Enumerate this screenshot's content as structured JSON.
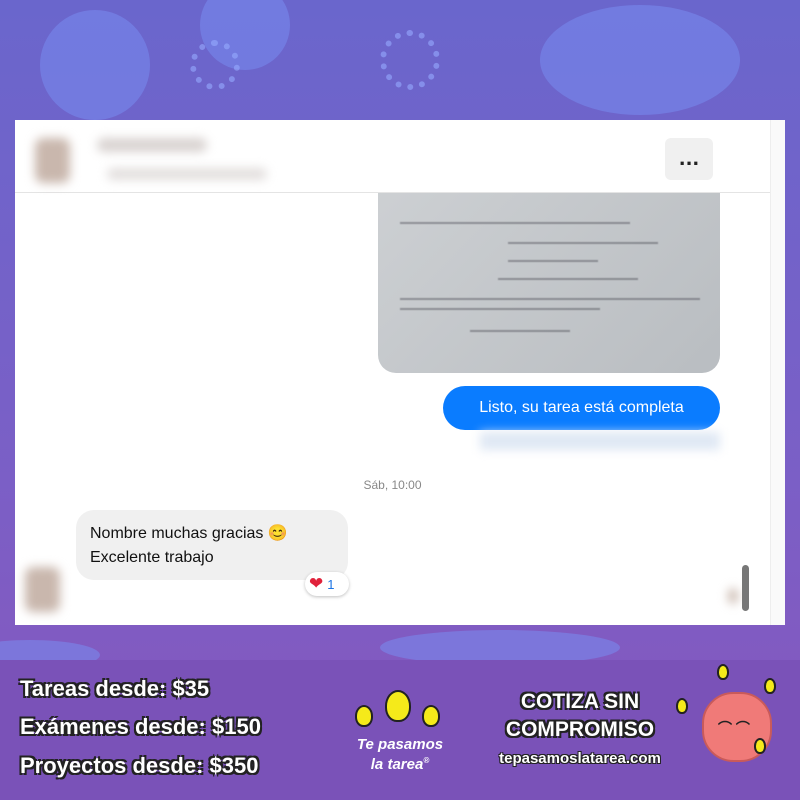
{
  "chat": {
    "more_label": "...",
    "outgoing_message": "Listo, su tarea está completa",
    "timestamp": "Sáb, 10:00",
    "incoming_lines": [
      "Nombre muchas gracias 😊",
      "Excelente trabajo"
    ],
    "reaction": {
      "emoji": "❤",
      "count": "1"
    }
  },
  "banner": {
    "prices": [
      "Tareas desde: $35",
      "Exámenes desde: $150",
      "Proyectos desde: $350"
    ],
    "logo_lines": [
      "Te pasamos",
      "la tarea"
    ],
    "logo_mark": "®",
    "cta_lines": [
      "COTIZA SIN",
      "COMPROMISO"
    ],
    "website": "tepasamoslatarea.com"
  },
  "colors": {
    "accent": "#0a7cff",
    "banner": "#7a52b8",
    "heart": "#e0213a"
  }
}
